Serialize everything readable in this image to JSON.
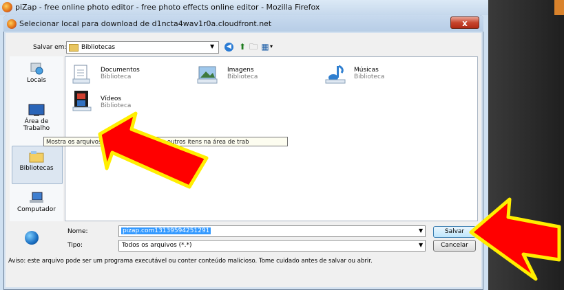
{
  "browser": {
    "title": "piZap - free online photo editor - free photo effects online editor - Mozilla Firefox"
  },
  "dialog": {
    "title": "Selecionar local para download de d1ncta4wav1r0a.cloudfront.net",
    "close_label": "x",
    "save_in_label": "Salvar em:",
    "location_value": "Bibliotecas"
  },
  "places": [
    {
      "label": "Locais",
      "icon": "recent-places-icon"
    },
    {
      "label_line1": "Área de",
      "label_line2": "Trabalho",
      "icon": "desktop-icon"
    },
    {
      "label": "Bibliotecas",
      "icon": "libraries-icon",
      "selected": true
    },
    {
      "label": "Computador",
      "icon": "computer-icon"
    }
  ],
  "files": [
    {
      "name": "Documentos",
      "sub": "Biblioteca",
      "icon": "documents-library-icon"
    },
    {
      "name": "Imagens",
      "sub": "Biblioteca",
      "icon": "pictures-library-icon"
    },
    {
      "name": "Músicas",
      "sub": "Biblioteca",
      "icon": "music-library-icon"
    },
    {
      "name": "Vídeos",
      "sub": "Biblioteca",
      "icon": "videos-library-icon"
    }
  ],
  "tooltip": "Mostra os arquivos, pastas, programas e outros itens na área de trab",
  "form": {
    "name_label": "Nome:",
    "name_value": "pizap.com13139594251291",
    "type_label": "Tipo:",
    "type_value": "Todos os arquivos (*.*)",
    "save_button": "Salvar",
    "cancel_button": "Cancelar"
  },
  "warning": "Aviso: este arquivo pode ser um programa executável ou conter conteúdo malicioso. Tome cuidado antes de salvar ou abrir.",
  "colors": {
    "arrow_fill": "#ff0000",
    "arrow_outline": "#ffee00",
    "selection": "#3399ff"
  }
}
